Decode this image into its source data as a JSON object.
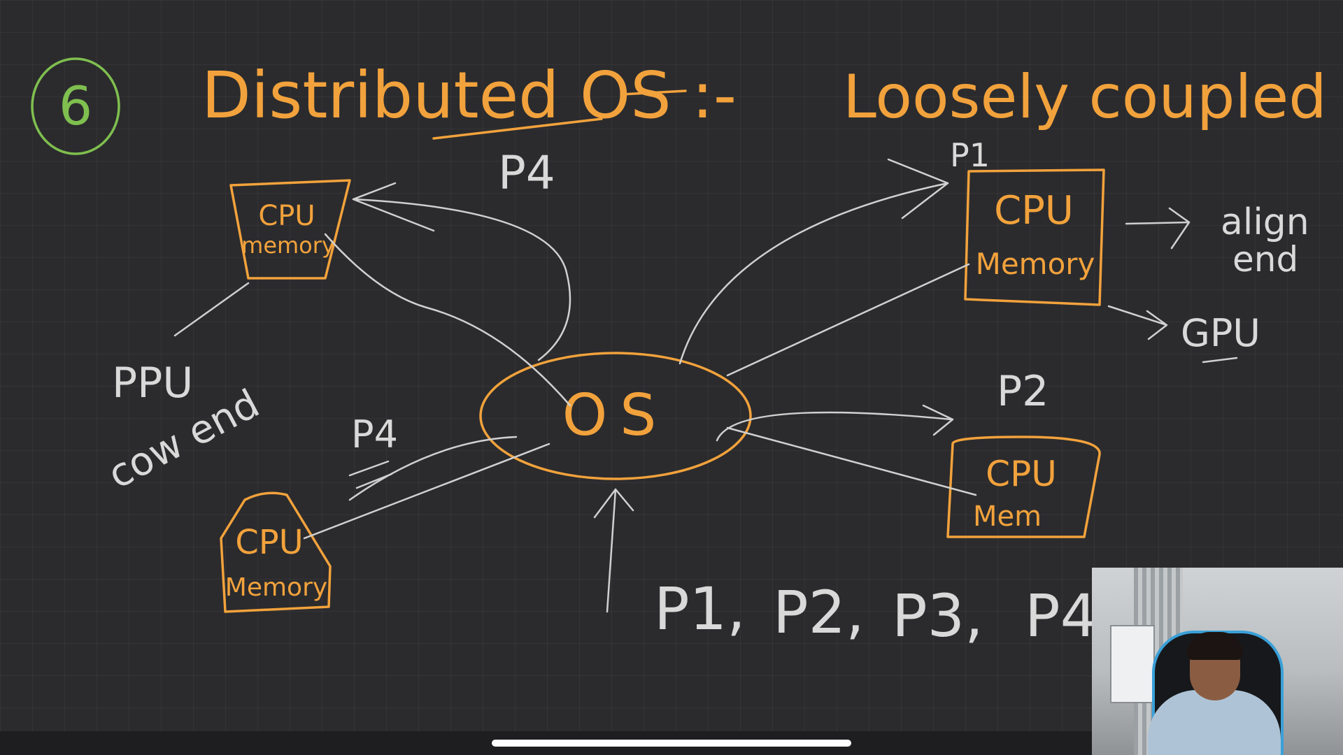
{
  "title": {
    "number": "6",
    "text": "Distributed OS :-",
    "subtitle": "Loosely coupled"
  },
  "center": {
    "label": "OS"
  },
  "nodes": [
    {
      "id": "node-top-left",
      "line1": "CPU",
      "line2": "memory"
    },
    {
      "id": "node-top-right",
      "line1": "CPU",
      "line2": "Memory"
    },
    {
      "id": "node-bottom-right",
      "line1": "CPU",
      "line2": "Mem"
    },
    {
      "id": "node-bottom-left",
      "line1": "CPU",
      "line2": "Memory"
    }
  ],
  "process_labels": {
    "top": "P4",
    "top_right": "P1",
    "right": "P2",
    "left": "P4"
  },
  "annotations": {
    "align_end_1": "align",
    "align_end_2": "end",
    "gpu": "GPU",
    "left_cpu": "PPU",
    "left_cow_end": "cow end"
  },
  "process_queue": [
    "P1,",
    "P2,",
    "P3,",
    "P4"
  ],
  "colors": {
    "board": "#2b2b2d",
    "orange_ink": "#f2a23c",
    "white_ink": "#d9d9d9",
    "green_ink": "#7fbf4f"
  }
}
